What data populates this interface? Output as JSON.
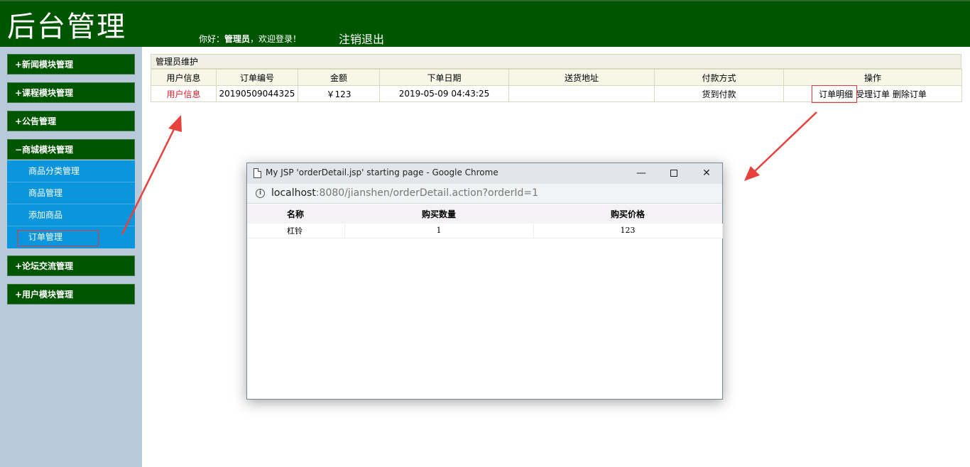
{
  "header": {
    "brand": "后台管理",
    "greeting_prefix": "你好：",
    "user": "管理员",
    "greeting_suffix": "，欢迎登录！",
    "logout": "注销退出"
  },
  "sidebar": {
    "menus": [
      {
        "sign": "+",
        "label": "新闻模块管理"
      },
      {
        "sign": "+",
        "label": "课程模块管理"
      },
      {
        "sign": "+",
        "label": "公告管理"
      },
      {
        "sign": "−",
        "label": "商城模块管理"
      },
      {
        "sign": "+",
        "label": "论坛交流管理"
      },
      {
        "sign": "+",
        "label": "用户模块管理"
      }
    ],
    "subitems": [
      {
        "label": "商品分类管理"
      },
      {
        "label": "商品管理"
      },
      {
        "label": "添加商品"
      },
      {
        "label": "订单管理"
      }
    ]
  },
  "main": {
    "panel_title": "管理员维护",
    "columns": [
      "用户信息",
      "订单编号",
      "金额",
      "下单日期",
      "送货地址",
      "付款方式",
      "操作"
    ],
    "rows": [
      {
        "user_info": "用户信息",
        "order_no": "20190509044325",
        "amount": "￥123",
        "date": "2019-05-09 04:43:25",
        "address": "",
        "payment": "货到付款",
        "op_detail": "订单明细",
        "op_accept": "受理订单",
        "op_delete": "删除订单"
      }
    ]
  },
  "popup": {
    "title": "My JSP 'orderDetail.jsp' starting page - Google Chrome",
    "url_host": "localhost",
    "url_rest": ":8080/jianshen/orderDetail.action?orderId=1",
    "columns": [
      "名称",
      "购买数量",
      "购买价格"
    ],
    "rows": [
      {
        "name": "杠铃",
        "qty": "1",
        "price": "123"
      }
    ]
  },
  "colors": {
    "header_green": "#005500",
    "sidebar_bg": "#b7c9da",
    "submenu_blue": "#0b95dd",
    "annotation_red": "#e03a3a"
  }
}
